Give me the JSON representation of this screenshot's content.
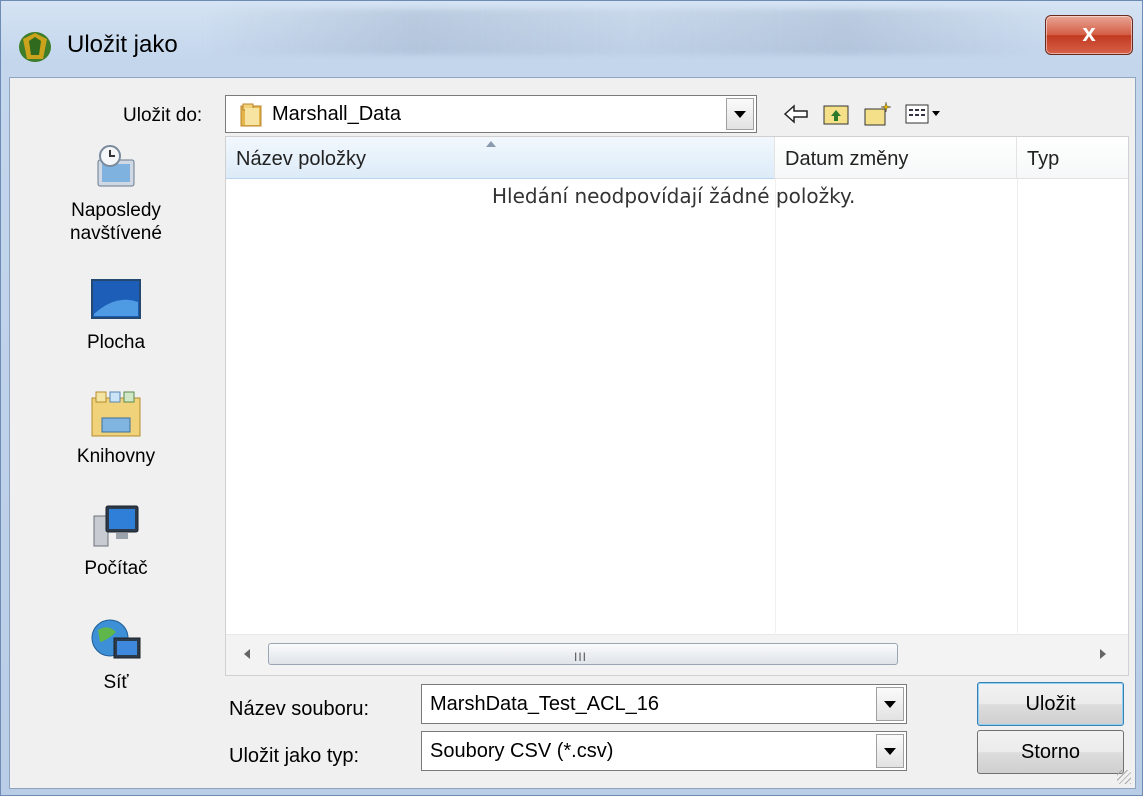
{
  "window": {
    "title": "Uložit jako",
    "close_label": "x",
    "accent": "#c0391f"
  },
  "save_in": {
    "label": "Uložit do:",
    "value": "Marshall_Data"
  },
  "places": [
    {
      "label": "Naposledy\nnavštívené",
      "icon": "recent-places-icon"
    },
    {
      "label": "Plocha",
      "icon": "desktop-icon"
    },
    {
      "label": "Knihovny",
      "icon": "libraries-icon"
    },
    {
      "label": "Počítač",
      "icon": "computer-icon"
    },
    {
      "label": "Síť",
      "icon": "network-icon"
    }
  ],
  "file_list": {
    "columns": [
      "Název položky",
      "Datum změny",
      "Typ"
    ],
    "empty_message": "Hledání neodpovídají žádné položky.",
    "scroll_grip": "III"
  },
  "file_name": {
    "label": "Název souboru:",
    "value": "MarshData_Test_ACL_16"
  },
  "file_type": {
    "label": "Uložit jako typ:",
    "value": "Soubory CSV (*.csv)"
  },
  "buttons": {
    "save": "Uložit",
    "cancel": "Storno"
  }
}
